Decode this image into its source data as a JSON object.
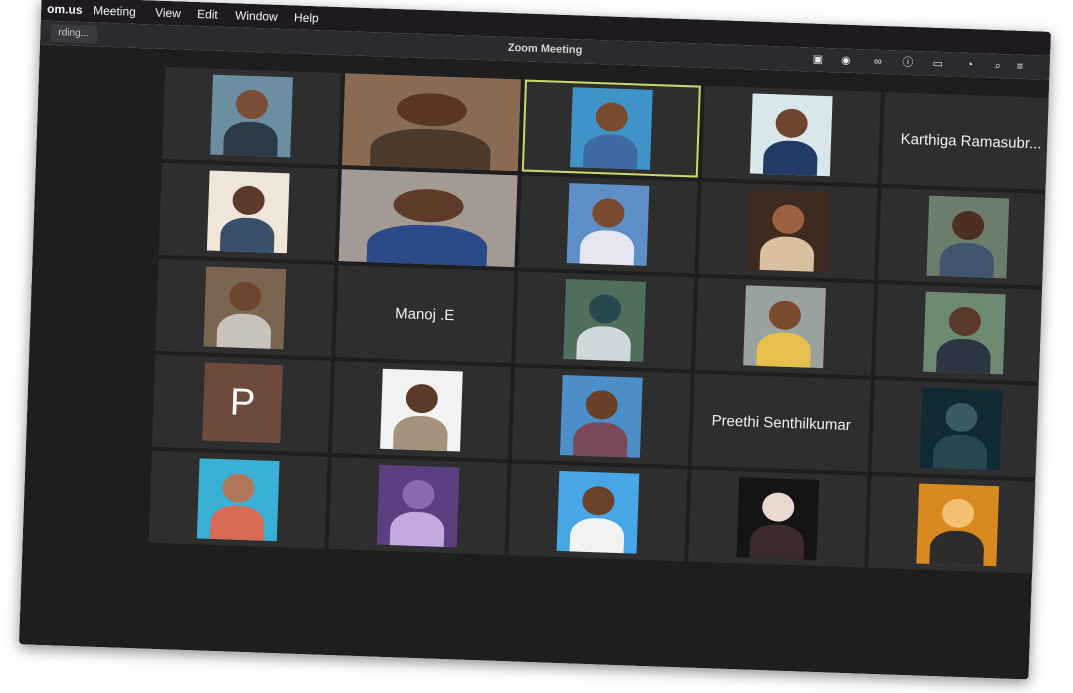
{
  "menubar": {
    "app_name": "om.us",
    "items": [
      "Meeting",
      "View",
      "Edit",
      "Window",
      "Help"
    ]
  },
  "titlebar": {
    "recording_chip": "rding...",
    "title": "Zoom Meeting"
  },
  "participants": [
    {
      "kind": "photo",
      "bg": "#6b8ea0",
      "skin": "#7a4e36",
      "shirt": "#2a3b46"
    },
    {
      "kind": "video",
      "bg": "#8a6b52",
      "skin": "#5a3622",
      "shirt": "#4b3a2c"
    },
    {
      "kind": "photo",
      "bg": "#3f93c9",
      "skin": "#7b4b2f",
      "shirt": "#3d6aa2",
      "active": true
    },
    {
      "kind": "photo",
      "bg": "#d9e6ec",
      "skin": "#6f4530",
      "shirt": "#213b66"
    },
    {
      "kind": "name",
      "name": "Karthiga Ramasubr..."
    },
    {
      "kind": "photo",
      "bg": "#efe6d9",
      "skin": "#5b3a2a",
      "shirt": "#3a4f6a"
    },
    {
      "kind": "video",
      "bg": "#a39a94",
      "skin": "#5e3a28",
      "shirt": "#2c4a8a"
    },
    {
      "kind": "photo",
      "bg": "#5f8fc7",
      "skin": "#7a4a32",
      "shirt": "#e6e6f2"
    },
    {
      "kind": "photo",
      "bg": "#3f2a1f",
      "skin": "#9b6242",
      "shirt": "#d8c0a0"
    },
    {
      "kind": "photo",
      "bg": "#6c7e6b",
      "skin": "#4c2f22",
      "shirt": "#43546e"
    },
    {
      "kind": "photo",
      "bg": "#7a6650",
      "skin": "#6e4630",
      "shirt": "#c8c2bc"
    },
    {
      "kind": "name",
      "name": "Manoj .E"
    },
    {
      "kind": "art",
      "bg": "#4f6f5a",
      "skin": "#2a4750",
      "shirt": "#cfd8dc"
    },
    {
      "kind": "photo",
      "bg": "#9aa2a0",
      "skin": "#7a4b2f",
      "shirt": "#e5c04c"
    },
    {
      "kind": "photo",
      "bg": "#6f8a73",
      "skin": "#5b3a2a",
      "shirt": "#2b3640"
    },
    {
      "kind": "letter",
      "letter": "P",
      "color": "#6e4a3e"
    },
    {
      "kind": "photo",
      "bg": "#f2f2f2",
      "skin": "#5a3a28",
      "shirt": "#a5927c"
    },
    {
      "kind": "photo",
      "bg": "#4c8ec7",
      "skin": "#6a4028",
      "shirt": "#7a4a5a"
    },
    {
      "kind": "name",
      "name": "Preethi Senthilkumar"
    },
    {
      "kind": "photo",
      "bg": "#0f2a33",
      "skin": "#3c5860",
      "shirt": "#274650"
    },
    {
      "kind": "photo",
      "bg": "#3ab0d6",
      "skin": "#b0765a",
      "shirt": "#d96a56"
    },
    {
      "kind": "art",
      "bg": "#5b3f80",
      "skin": "#8a6bb0",
      "shirt": "#c4a8e0"
    },
    {
      "kind": "photo",
      "bg": "#46a6e6",
      "skin": "#6a412b",
      "shirt": "#f2f2f2"
    },
    {
      "kind": "art",
      "bg": "#141414",
      "skin": "#e8d8d0",
      "shirt": "#3a2a2a"
    },
    {
      "kind": "art",
      "bg": "#d88a20",
      "skin": "#f2c070",
      "shirt": "#2c2c2c"
    }
  ],
  "colors": {
    "active_outline": "#c8d96a",
    "tile_bg": "#2e2e2e",
    "stage_bg": "#1e1e1e"
  }
}
